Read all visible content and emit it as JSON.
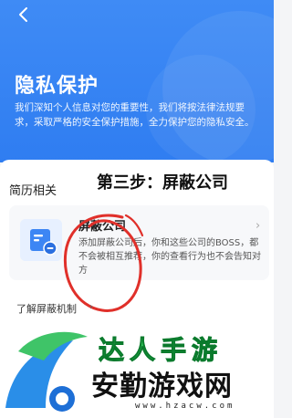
{
  "header": {
    "title": "隐私保护",
    "description": "我们深知个人信息对您的重要性，我们将按法律法规要求，采取严格的安全保护措施，全力保护您的隐私安全。"
  },
  "section": {
    "title": "简历相关",
    "step_label": "第三步：屏蔽公司"
  },
  "card": {
    "title": "屏蔽公司",
    "description": "添加屏蔽公司后，你和这些公司的BOSS，都不会被相互推荐，你的查看行为也不会告知对方",
    "chevron": "›"
  },
  "learn_more": {
    "label": "了解屏蔽机制",
    "chevron": "›"
  },
  "watermark": {
    "top_text": "达人手游",
    "main_text": "安勤游戏网",
    "url": "www.hzacw.com"
  },
  "icons": [
    "back-arrow-icon",
    "company-block-icon",
    "chevron-right-icon",
    "watermark-logo-icon"
  ],
  "colors": {
    "hero_blue": "#2f7df1",
    "annotation_red": "#e0302a",
    "watermark_green": "#32c65a"
  }
}
